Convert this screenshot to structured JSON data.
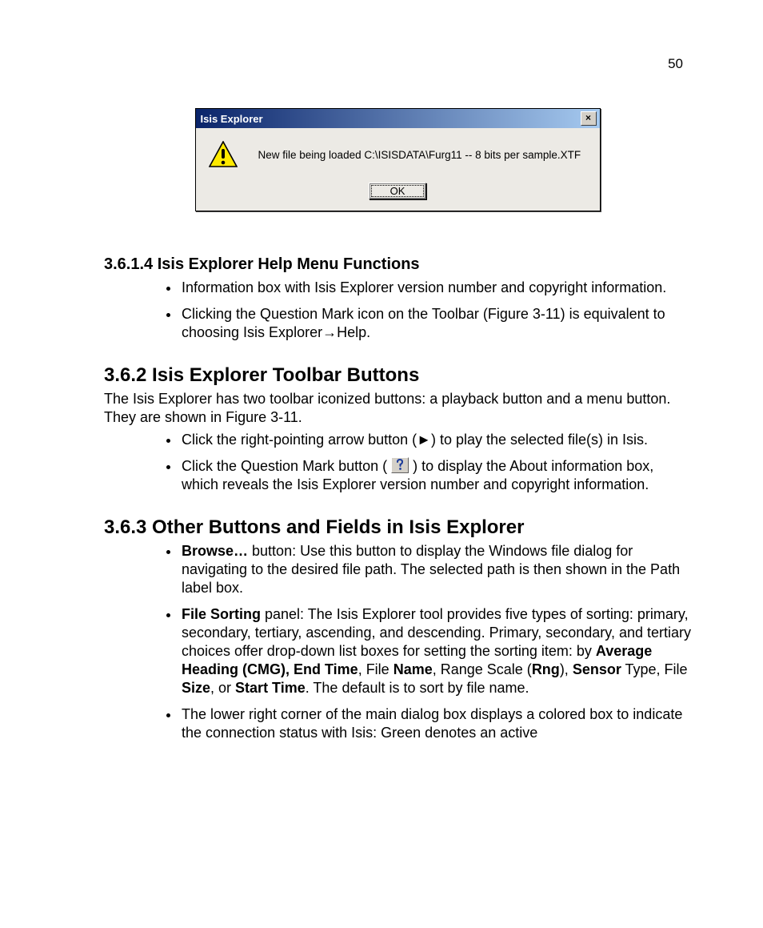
{
  "page_number": "50",
  "dialog": {
    "title": "Isis Explorer",
    "close_label": "×",
    "message": "New file being loaded C:\\ISISDATA\\Furg11 -- 8 bits per sample.XTF",
    "ok_label": "OK"
  },
  "s3614": {
    "heading": "3.6.1.4 Isis Explorer Help Menu Functions",
    "bullets": [
      "Information box with Isis Explorer version number and copyright information.",
      "Clicking the Question Mark icon on the Toolbar (Figure 3-11) is equivalent to choosing Isis Explorer→Help."
    ]
  },
  "s362": {
    "heading": "3.6.2 Isis Explorer Toolbar Buttons",
    "para": "The Isis Explorer has two toolbar iconized buttons: a playback button and a menu button. They are shown in Figure 3-11.",
    "b1": "Click the right-pointing arrow button (►) to play the selected file(s) in Isis.",
    "b2_pre": "Click the Question Mark button ( ",
    "b2_post": " ) to display the About information box, which reveals the Isis Explorer version number and copyright information."
  },
  "s363": {
    "heading": "3.6.3 Other Buttons and Fields in Isis Explorer",
    "b1_bold": "Browse…",
    "b1_rest": "  button: Use this button to display the Windows file dialog for navigating to the desired file path. The selected path is then shown in the Path label box.",
    "b2_bold1": "File Sorting",
    "b2_t1": " panel: The Isis Explorer tool provides five types of sorting: primary, secondary, tertiary, ascending, and descending. Primary, secondary, and tertiary choices offer drop-down list boxes for setting the sorting item: by ",
    "b2_bold2": "Average Heading (CMG), End Time",
    "b2_t2": ", File ",
    "b2_bold3": "Name",
    "b2_t3": ", Range Scale (",
    "b2_bold4": "Rng",
    "b2_t4": "), ",
    "b2_bold5": "Sensor",
    "b2_t5": " Type, File ",
    "b2_bold6": "Size",
    "b2_t6": ", or ",
    "b2_bold7": "Start Time",
    "b2_t7": ". The default is to sort by file name.",
    "b3": "The lower right corner of the main dialog box displays a colored box to indicate the connection status with Isis: Green denotes an active"
  }
}
